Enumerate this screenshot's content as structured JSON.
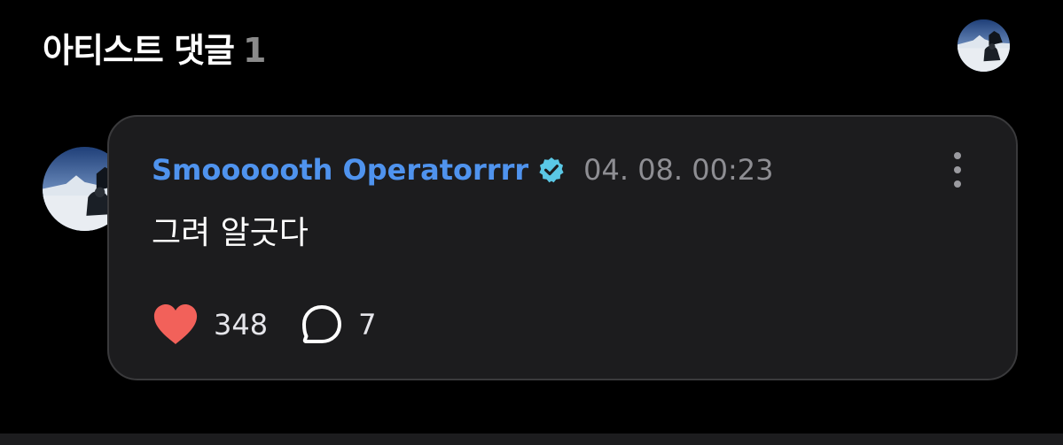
{
  "header": {
    "title": "아티스트 댓글",
    "count": "1"
  },
  "comment": {
    "author": "Smoooooth Operatorrrr",
    "verified": true,
    "timestamp": "04. 08. 00:23",
    "text": "그려 알긋다",
    "likes": "348",
    "replies": "7"
  },
  "icons": {
    "more": "more-vertical-icon",
    "verified": "verified-badge-icon",
    "like": "heart-icon",
    "reply": "speech-bubble-icon"
  },
  "colors": {
    "background": "#000000",
    "card": "#1c1c1e",
    "author": "#4f93ee",
    "verified_badge": "#5ac8e6",
    "heart": "#f2615a",
    "timestamp": "#8e8e93"
  }
}
